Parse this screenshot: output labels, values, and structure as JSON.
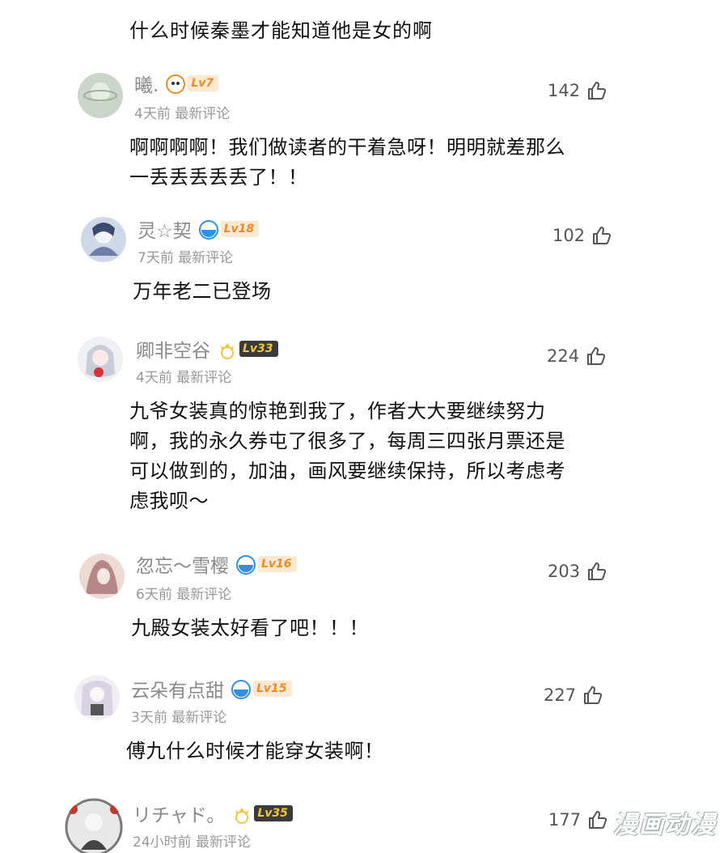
{
  "previous_comment_text": "什么时候秦墨才能知道他是女的啊",
  "comments": [
    {
      "username": "曦.",
      "level": "Lv7",
      "time": "4天前",
      "tag": "最新评论",
      "likes": "142",
      "text": [
        "啊啊啊啊！我们做读者的干着急呀！明明就差那么",
        "一丢丢丢丢丢了！！"
      ]
    },
    {
      "username": "灵☆契",
      "level": "Lv18",
      "time": "7天前",
      "tag": "最新评论",
      "likes": "102",
      "text": [
        "万年老二已登场"
      ]
    },
    {
      "username": "卿非空谷",
      "level": "Lv33",
      "time": "4天前",
      "tag": "最新评论",
      "likes": "224",
      "text": [
        "九爷女装真的惊艳到我了，作者大大要继续努力",
        "啊，我的永久券屯了很多了，每周三四张月票还是",
        "可以做到的，加油，画风要继续保持，所以考虑考",
        "虑我呗～"
      ]
    },
    {
      "username": "忽忘～雪樱",
      "level": "Lv16",
      "time": "6天前",
      "tag": "最新评论",
      "likes": "203",
      "text": [
        "九殿女装太好看了吧！！！"
      ]
    },
    {
      "username": "云朵有点甜",
      "level": "Lv15",
      "time": "3天前",
      "tag": "最新评论",
      "likes": "227",
      "text": [
        "傅九什么时候才能穿女装啊！"
      ]
    },
    {
      "username": "リチャド。",
      "level": "Lv35",
      "time": "24小时前",
      "tag": "最新评论",
      "likes": "177",
      "text": []
    }
  ],
  "watermark": "漫画动漫",
  "icons": {
    "like": "thumbs-up-icon",
    "level": "level-badge-icon"
  },
  "colors": {
    "username": "#8a8a8a",
    "meta": "#999999",
    "badge_orange": "#f08a24",
    "badge_dark": "#3b3b3b"
  }
}
